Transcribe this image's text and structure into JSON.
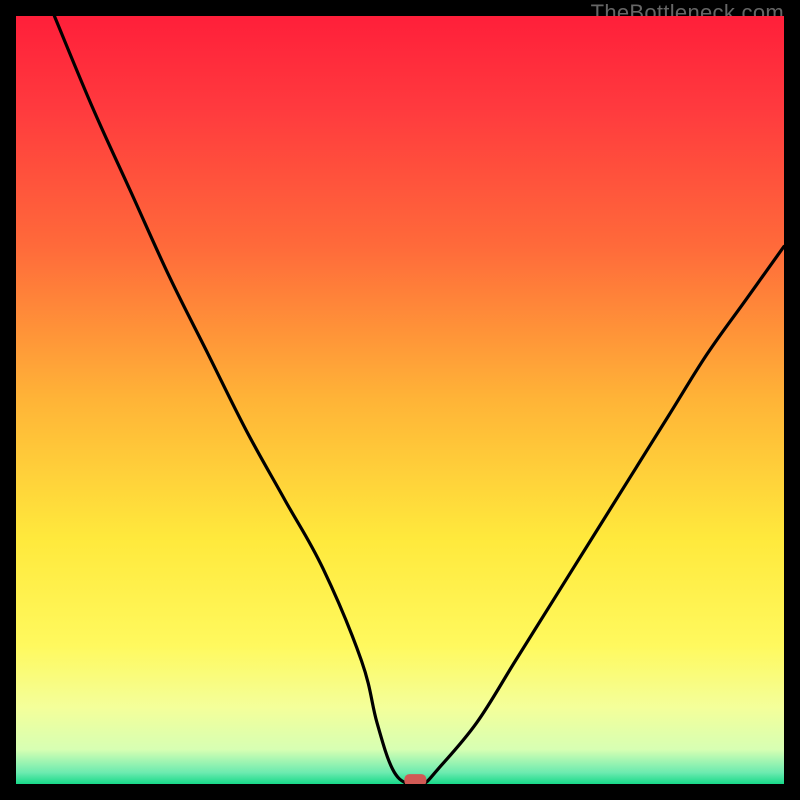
{
  "brand": "TheBottleneck.com",
  "chart_data": {
    "type": "line",
    "title": "",
    "xlabel": "",
    "ylabel": "",
    "xlim": [
      0,
      100
    ],
    "ylim": [
      0,
      100
    ],
    "series": [
      {
        "name": "curve",
        "x": [
          5,
          10,
          15,
          20,
          25,
          30,
          35,
          40,
          45,
          47,
          49,
          51,
          53,
          55,
          60,
          65,
          70,
          75,
          80,
          85,
          90,
          95,
          100
        ],
        "y": [
          100,
          88,
          77,
          66,
          56,
          46,
          37,
          28,
          16,
          8,
          2,
          0,
          0,
          2,
          8,
          16,
          24,
          32,
          40,
          48,
          56,
          63,
          70
        ]
      }
    ],
    "marker": {
      "x": 52,
      "y": 0.5,
      "color": "#d15a55"
    },
    "gradient_stops": [
      {
        "pos": 0.0,
        "color": "#ff1f3a"
      },
      {
        "pos": 0.12,
        "color": "#ff3a3e"
      },
      {
        "pos": 0.3,
        "color": "#ff6a3a"
      },
      {
        "pos": 0.5,
        "color": "#ffb437"
      },
      {
        "pos": 0.68,
        "color": "#ffe93c"
      },
      {
        "pos": 0.82,
        "color": "#fff95e"
      },
      {
        "pos": 0.9,
        "color": "#f4ff9a"
      },
      {
        "pos": 0.955,
        "color": "#d7ffb3"
      },
      {
        "pos": 0.985,
        "color": "#6debb0"
      },
      {
        "pos": 1.0,
        "color": "#17d989"
      }
    ]
  }
}
